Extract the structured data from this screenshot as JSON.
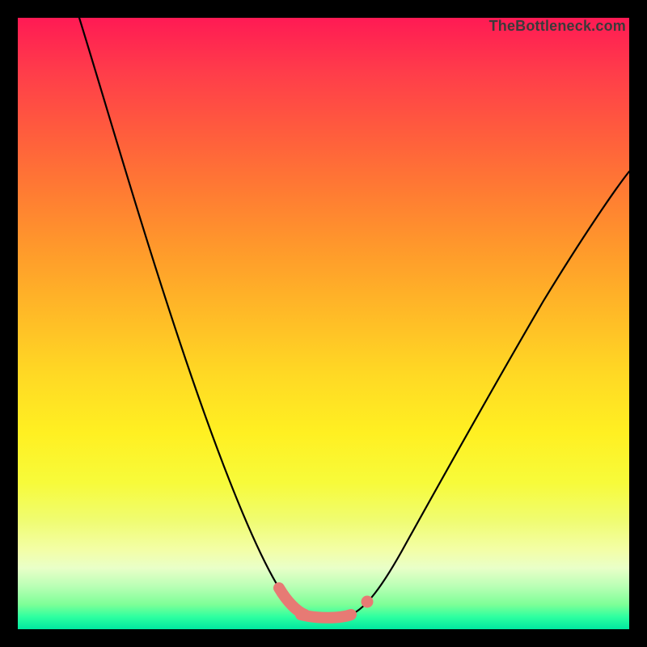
{
  "watermark": "TheBottleneck.com",
  "colors": {
    "background": "#000000",
    "curve": "#000000",
    "accent": "#e77a74"
  },
  "chart_data": {
    "type": "line",
    "title": "",
    "xlabel": "",
    "ylabel": "",
    "xlim": [
      0,
      100
    ],
    "ylim": [
      0,
      100
    ],
    "grid": false,
    "legend": false,
    "series": [
      {
        "name": "bottleneck-curve",
        "x": [
          10,
          14,
          18,
          22,
          26,
          30,
          34,
          38,
          41,
          43,
          45,
          48,
          52,
          55,
          58,
          62,
          68,
          76,
          85,
          95,
          100
        ],
        "y": [
          100,
          90,
          79,
          68,
          57,
          46,
          35,
          24,
          14,
          8,
          4,
          2,
          2,
          3,
          6,
          12,
          22,
          36,
          52,
          68,
          75
        ]
      }
    ],
    "highlight": {
      "name": "minimum-region",
      "segment_x": [
        43,
        54
      ],
      "segment_y": [
        5,
        2.5
      ],
      "dot": {
        "x": 56.5,
        "y": 5
      }
    },
    "background_gradient": {
      "stops": [
        {
          "pos": 0.0,
          "color": "#ff1a54"
        },
        {
          "pos": 0.5,
          "color": "#ffc726"
        },
        {
          "pos": 0.8,
          "color": "#f6fd58"
        },
        {
          "pos": 1.0,
          "color": "#00e7a0"
        }
      ]
    }
  }
}
